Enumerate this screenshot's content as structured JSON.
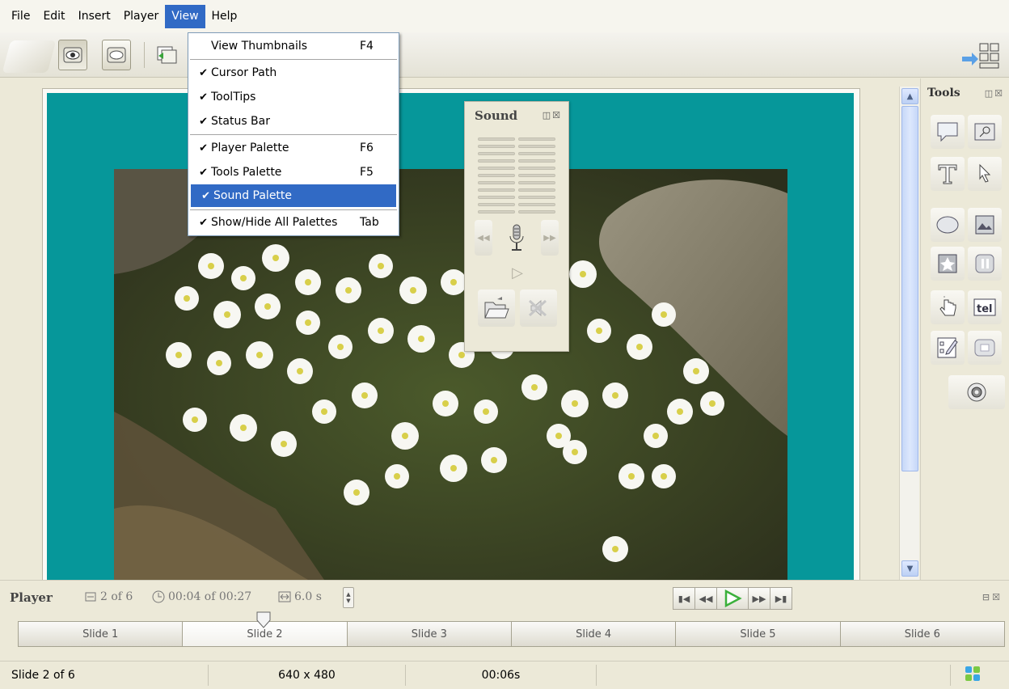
{
  "menubar": {
    "items": [
      {
        "label": "File"
      },
      {
        "label": "Edit"
      },
      {
        "label": "Insert"
      },
      {
        "label": "Player"
      },
      {
        "label": "View",
        "active": true
      },
      {
        "label": "Help"
      }
    ]
  },
  "view_menu": {
    "items": [
      {
        "label": "View Thumbnails",
        "checked": false,
        "shortcut": "F4"
      },
      {
        "label": "Cursor Path",
        "checked": true,
        "shortcut": ""
      },
      {
        "label": "ToolTips",
        "checked": true,
        "shortcut": ""
      },
      {
        "label": "Status Bar",
        "checked": true,
        "shortcut": ""
      },
      {
        "label": "Player Palette",
        "checked": true,
        "shortcut": "F6"
      },
      {
        "label": "Tools Palette",
        "checked": true,
        "shortcut": "F5"
      },
      {
        "label": "Sound Palette",
        "checked": true,
        "shortcut": "",
        "highlighted": true
      },
      {
        "label": "Show/Hide All Palettes",
        "checked": true,
        "shortcut": "Tab"
      }
    ],
    "check_glyph": "✔"
  },
  "toolbar": {
    "buttons": [
      {
        "icon": "eye-icon",
        "pressed": true
      },
      {
        "icon": "ellipse-view-icon",
        "pressed": false
      },
      {
        "icon": "slide-properties-icon",
        "pressed": false
      }
    ],
    "right_icon": "layout-toggle-icon"
  },
  "sound_palette": {
    "title": "Sound",
    "meter_bars": 11,
    "buttons": [
      "rewind-icon",
      "microphone-icon",
      "fast-forward-icon",
      "play-icon",
      "open-folder-icon",
      "mute-icon"
    ]
  },
  "tools_palette": {
    "title": "Tools",
    "tools": [
      "callout-icon",
      "zoom-box-icon",
      "text-icon",
      "cursor-arrow-icon",
      "highlight-oval-icon",
      "image-icon",
      "image-placeholder-icon",
      "pause-icon",
      "click-hand-icon",
      "text-entry-icon",
      "quiz-icon",
      "screen-area-icon",
      "record-icon"
    ]
  },
  "player": {
    "label": "Player",
    "slide_position": "2 of 6",
    "time": "00:04 of 00:27",
    "duration": "6.0 s",
    "colors": {
      "play": "#3bb03b"
    },
    "slides": [
      {
        "label": "Slide 1"
      },
      {
        "label": "Slide 2",
        "current": true
      },
      {
        "label": "Slide 3"
      },
      {
        "label": "Slide 4"
      },
      {
        "label": "Slide 5"
      },
      {
        "label": "Slide 6"
      }
    ]
  },
  "statusbar": {
    "slide": "Slide 2 of 6",
    "resolution": "640 x 480",
    "elapsed": "00:06s",
    "icon": "network-status-icon"
  },
  "colors": {
    "slide_background": "#06979a",
    "menu_highlight": "#316ac5"
  }
}
